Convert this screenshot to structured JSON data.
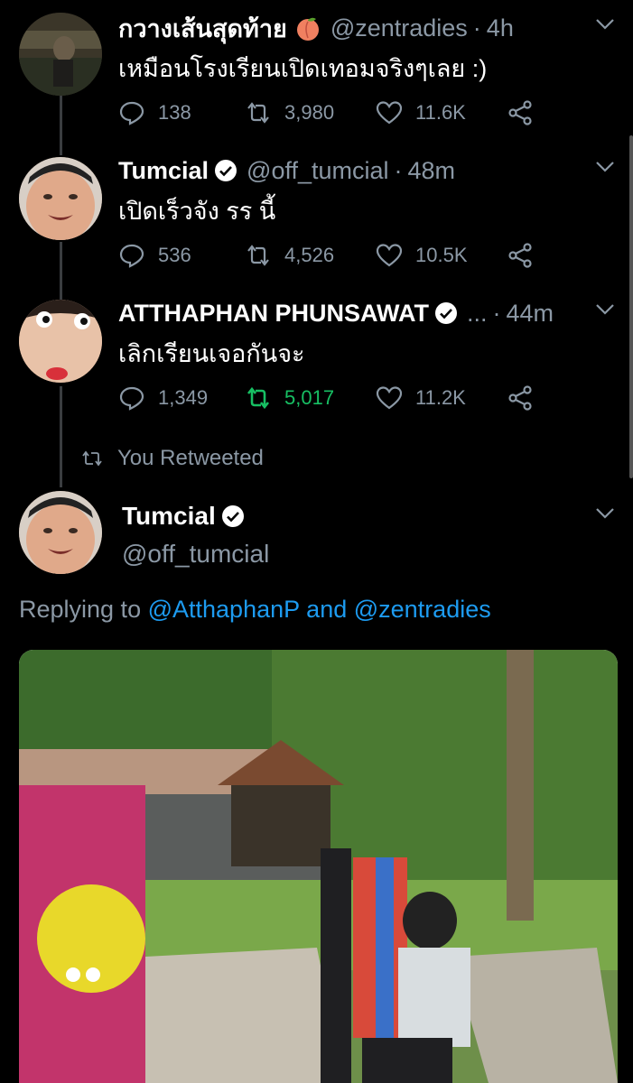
{
  "thread": [
    {
      "name": "กวางเส้นสุดท้าย",
      "handle": "@zentradies",
      "time": "4h",
      "text": "เหมือนโรงเรียนเปิดเทอมจริงๆเลย :)",
      "replies": "138",
      "retweets": "3,980",
      "likes": "11.6K",
      "emoji": "peach-icon"
    },
    {
      "name": "Tumcial",
      "handle": "@off_tumcial",
      "time": "48m",
      "text": "เปิดเร็วจัง รร นี้",
      "replies": "536",
      "retweets": "4,526",
      "likes": "10.5K",
      "verified": true
    },
    {
      "name": "ATTHAPHAN PHUNSAWAT",
      "handle": "...",
      "time": "44m",
      "text": "เลิกเรียนเจอกันจะ",
      "replies": "1,349",
      "retweets": "5,017",
      "likes": "11.2K",
      "verified": true,
      "retweeted_by_you": true
    }
  ],
  "retweet_note": "You Retweeted",
  "focused_tweet": {
    "name": "Tumcial",
    "handle": "@off_tumcial",
    "replying_prefix": "Replying to",
    "mention_1": "@AtthaphanP",
    "conjunction": "and",
    "mention_2": "@zentradies"
  },
  "colors": {
    "background": "#000000",
    "secondary_text": "#8b98a5",
    "link": "#1d9bf0",
    "retweet_active": "#17bf63"
  }
}
